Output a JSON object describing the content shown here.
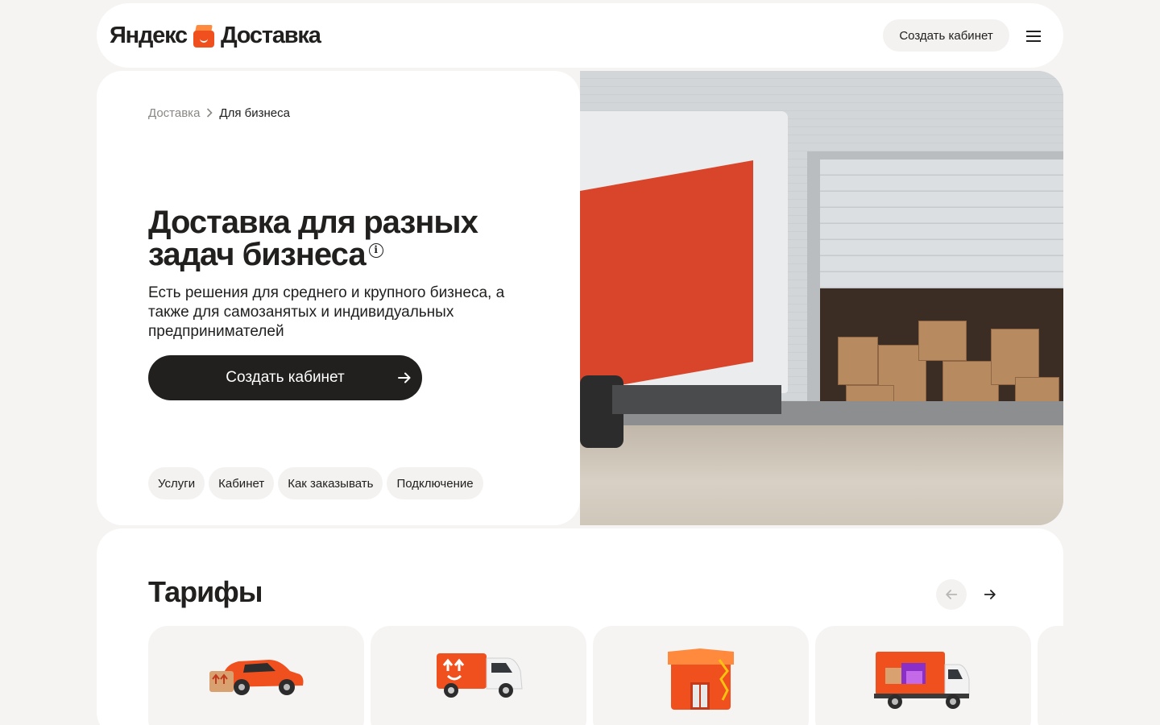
{
  "header": {
    "logo_brand": "Яндекс",
    "logo_product": "Доставка",
    "cta_label": "Создать кабинет",
    "menu_icon": "menu-icon"
  },
  "hero": {
    "breadcrumbs": [
      "Доставка",
      "Для бизнеса"
    ],
    "title": "Доставка для разных задач бизнеса",
    "subtitle": "Есть решения для среднего и крупного бизнеса, а также для самозанятых и индивидуальных предпринимателей",
    "cta_label": "Создать кабинет",
    "pills": [
      "Услуги",
      "Кабинет",
      "Как заказывать",
      "Подключение"
    ]
  },
  "tariffs": {
    "title": "Тарифы",
    "cards": [
      {
        "icon": "car-icon"
      },
      {
        "icon": "van-icon"
      },
      {
        "icon": "warehouse-icon"
      },
      {
        "icon": "truck-icon"
      }
    ]
  },
  "colors": {
    "accent": "#f0501e",
    "dark": "#21201f",
    "pill_bg": "#f3f2f1",
    "page_bg": "#f5f4f2"
  }
}
